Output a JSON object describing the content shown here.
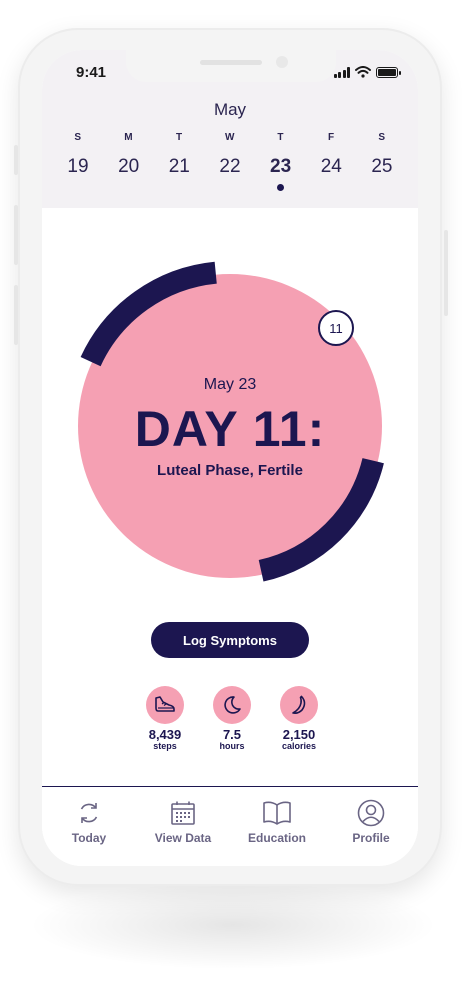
{
  "status_bar": {
    "time": "9:41"
  },
  "calendar": {
    "month": "May",
    "days": [
      {
        "dow": "S",
        "num": "19"
      },
      {
        "dow": "M",
        "num": "20"
      },
      {
        "dow": "T",
        "num": "21"
      },
      {
        "dow": "W",
        "num": "22"
      },
      {
        "dow": "T",
        "num": "23",
        "active": true
      },
      {
        "dow": "F",
        "num": "24"
      },
      {
        "dow": "S",
        "num": "25"
      }
    ]
  },
  "cycle": {
    "date": "May 23",
    "day_title": "DAY 11:",
    "phase": "Luteal Phase, Fertile",
    "badge": "11"
  },
  "log_button": "Log Symptoms",
  "stats": [
    {
      "icon": "shoe-icon",
      "value": "8,439",
      "label": "steps"
    },
    {
      "icon": "moon-icon",
      "value": "7.5",
      "label": "hours"
    },
    {
      "icon": "banana-icon",
      "value": "2,150",
      "label": "calories"
    }
  ],
  "tabs": [
    {
      "icon": "refresh-icon",
      "label": "Today"
    },
    {
      "icon": "calendar-icon",
      "label": "View Data"
    },
    {
      "icon": "book-icon",
      "label": "Education"
    },
    {
      "icon": "user-icon",
      "label": "Profile"
    }
  ],
  "colors": {
    "navy": "#1c1650",
    "pink": "#f5a0b3",
    "header_bg": "#f3f1f4"
  }
}
